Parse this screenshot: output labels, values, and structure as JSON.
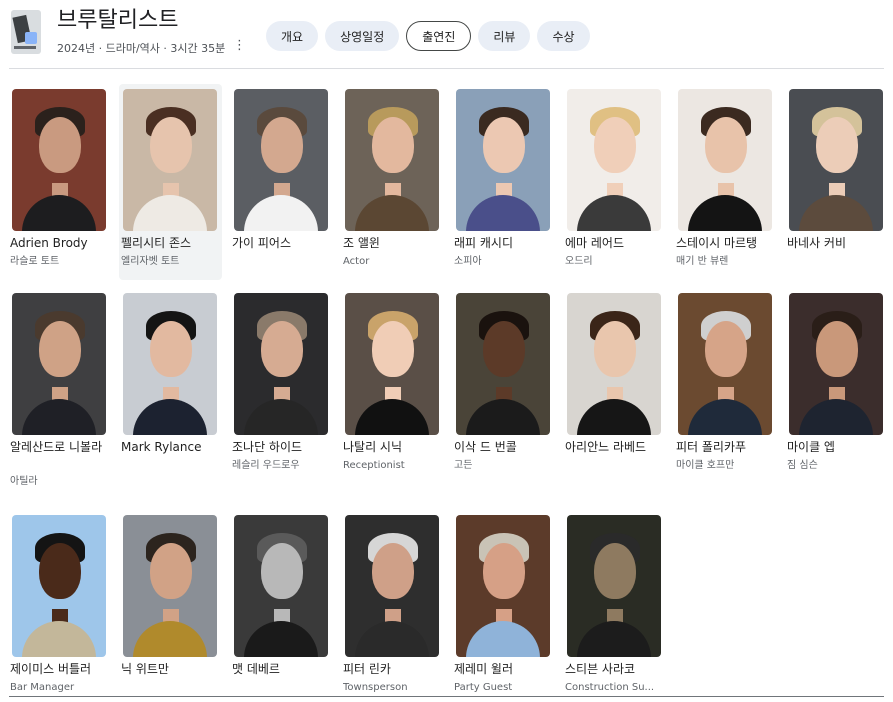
{
  "header": {
    "title": "브루탈리스트",
    "meta": "2024년 · 드라마/역사 · 3시간 35분",
    "more_icon": "⋮",
    "tabs": [
      {
        "label": "개요"
      },
      {
        "label": "상영일정"
      },
      {
        "label": "출연진",
        "active": true
      },
      {
        "label": "리뷰"
      },
      {
        "label": "수상"
      }
    ]
  },
  "cast": [
    {
      "name": "Adrien Brody",
      "role": "라슬로 토트",
      "bg": "#7a3b2e",
      "skin": "#c99a80",
      "hair": "#2b211c",
      "cloth": "#1d1d1f"
    },
    {
      "name": "펠리시티 존스",
      "role": "엘리자벳 토트",
      "bg": "#c9b8a6",
      "skin": "#e6c4ad",
      "hair": "#4a2f22",
      "cloth": "#eeeae4",
      "selected": true
    },
    {
      "name": "가이 피어스",
      "role": "",
      "bg": "#5b5e63",
      "skin": "#d3a88f",
      "hair": "#5a4a3d",
      "cloth": "#f2f2f2"
    },
    {
      "name": "조 앨윈",
      "role": "Actor",
      "bg": "#6d6358",
      "skin": "#e3b89e",
      "hair": "#b89a5c",
      "cloth": "#5b4733"
    },
    {
      "name": "래피 캐시디",
      "role": "소피아",
      "bg": "#8aa0b8",
      "skin": "#ecc8b2",
      "hair": "#3a2a20",
      "cloth": "#4a4f8a"
    },
    {
      "name": "에마 레어드",
      "role": "오드리",
      "bg": "#f1ede9",
      "skin": "#f0cfb9",
      "hair": "#e0c083",
      "cloth": "#3a3a3a"
    },
    {
      "name": "스테이시 마르탱",
      "role": "매기 반 뷰렌",
      "bg": "#ece7e2",
      "skin": "#e8c3aa",
      "hair": "#3b2a20",
      "cloth": "#141414"
    },
    {
      "name": "바네사 커비",
      "role": "",
      "bg": "#4a4d52",
      "skin": "#eccdb8",
      "hair": "#d4c29a",
      "cloth": "#5c4b3d"
    },
    {
      "name": "알레산드로 니볼라",
      "role": "아틸라",
      "bg": "#3f3f41",
      "skin": "#cfa286",
      "hair": "#4a3a2e",
      "cloth": "#1f2026"
    },
    {
      "name": "Mark Rylance",
      "role": "",
      "bg": "#c8ccd2",
      "skin": "#e2b9a0",
      "hair": "#141414",
      "cloth": "#1c2230"
    },
    {
      "name": "조나단 하이드",
      "role": "레슬리 우드로우",
      "bg": "#2b2b2d",
      "skin": "#d6ab92",
      "hair": "#8a7a6a",
      "cloth": "#262626"
    },
    {
      "name": "나탈리 시닉",
      "role": "Receptionist",
      "bg": "#5a4f47",
      "skin": "#f0cdb6",
      "hair": "#c9a36a",
      "cloth": "#111111"
    },
    {
      "name": "이삭 드 번콜",
      "role": "고든",
      "bg": "#4a4438",
      "skin": "#5c3a28",
      "hair": "#1a120e",
      "cloth": "#1b1b1b"
    },
    {
      "name": "아리안느 라베드",
      "role": "",
      "bg": "#d8d5d0",
      "skin": "#e9c6ad",
      "hair": "#3b2518",
      "cloth": "#161616"
    },
    {
      "name": "피터 폴리카푸",
      "role": "마이클 호프만",
      "bg": "#6b4a30",
      "skin": "#d6a488",
      "hair": "#cfcfcf",
      "cloth": "#1f2a3a"
    },
    {
      "name": "마이클 엡",
      "role": "짐 심슨",
      "bg": "#3b2d2c",
      "skin": "#c9987a",
      "hair": "#2a1e18",
      "cloth": "#1e2430"
    },
    {
      "name": "제이미스 버틀러",
      "role": "Bar Manager",
      "bg": "#9ec6ea",
      "skin": "#4a2a1a",
      "hair": "#141414",
      "cloth": "#c3b79a"
    },
    {
      "name": "닉 위트만",
      "role": "",
      "bg": "#8a8f96",
      "skin": "#d1a286",
      "hair": "#2c241e",
      "cloth": "#b08a2c"
    },
    {
      "name": "맷 데베르",
      "role": "",
      "bg": "#3a3a3a",
      "skin": "#b8b8b8",
      "hair": "#5a5a5a",
      "cloth": "#1a1a1a"
    },
    {
      "name": "피터 린카",
      "role": "Townsperson",
      "bg": "#2e2e2e",
      "skin": "#cfa088",
      "hair": "#d6d6d6",
      "cloth": "#2a2a2a"
    },
    {
      "name": "제레미 윌러",
      "role": "Party Guest",
      "bg": "#5c3b2a",
      "skin": "#d6a086",
      "hair": "#c9c3b6",
      "cloth": "#8fb3d9"
    },
    {
      "name": "스티븐 사라코",
      "role": "Construction Su...",
      "bg": "#2a2c24",
      "skin": "#8e7a60",
      "hair": "#2a2a2a",
      "cloth": "#1c1c1c"
    }
  ]
}
